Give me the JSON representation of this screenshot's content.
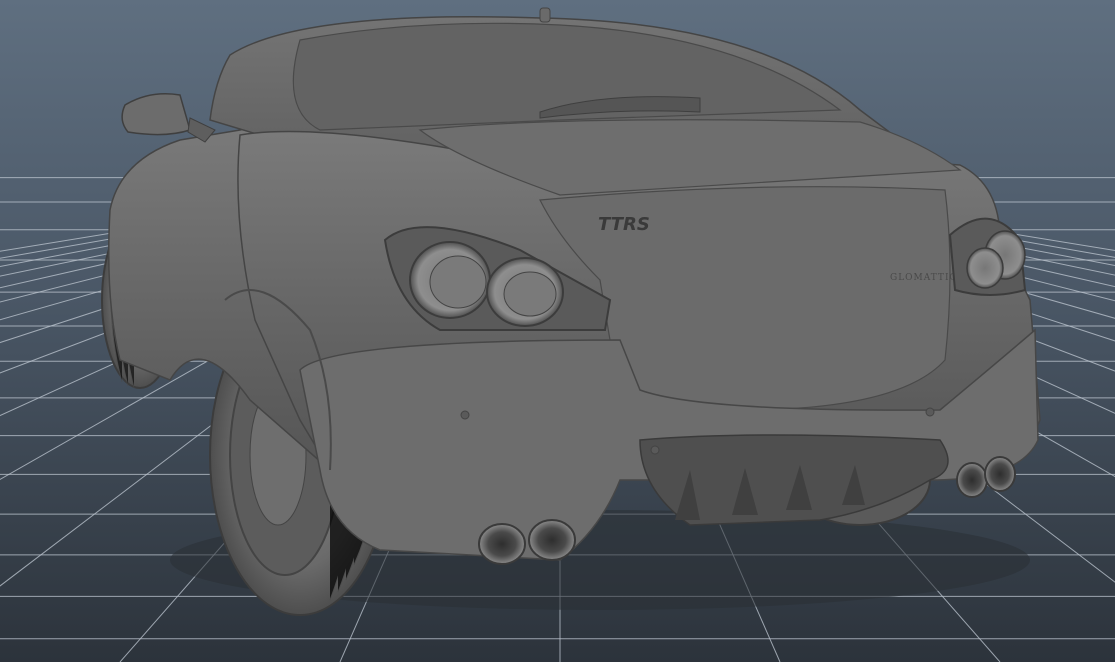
{
  "viewport": {
    "background_top": "#5f6f80",
    "background_bottom": "#2c333b",
    "grid_color": "#b9c2cc",
    "body_color": "#6a6a6a"
  },
  "car": {
    "badge_text": "TTRS",
    "model_text": "GLOMATTIGUE"
  }
}
